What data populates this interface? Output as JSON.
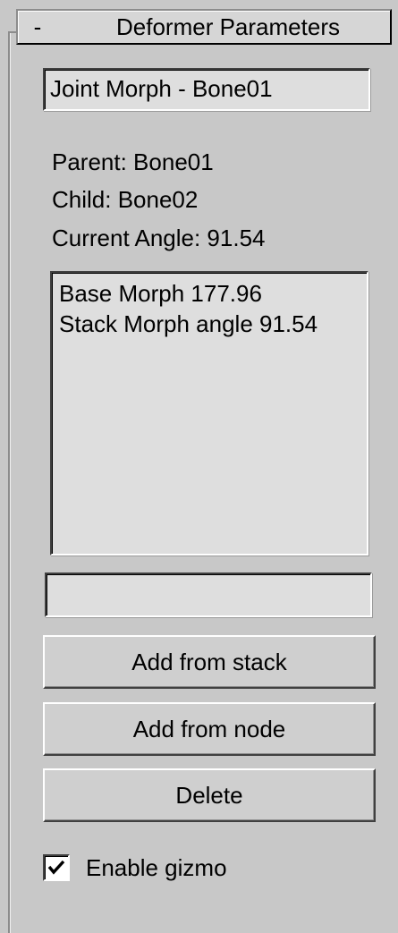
{
  "rollout": {
    "toggle": "-",
    "title": "Deformer Parameters"
  },
  "name_field": {
    "value": "Joint Morph - Bone01"
  },
  "info": {
    "parent": "Parent: Bone01",
    "child": "Child: Bone02",
    "current_angle": "Current Angle: 91.54"
  },
  "morph_list": {
    "items": [
      "Base Morph 177.96",
      "Stack Morph angle 91.54"
    ]
  },
  "edit_field": {
    "value": ""
  },
  "buttons": {
    "add_from_stack": "Add from stack",
    "add_from_node": "Add from node",
    "delete": "Delete"
  },
  "enable_gizmo": {
    "label": "Enable gizmo",
    "checked": true
  }
}
